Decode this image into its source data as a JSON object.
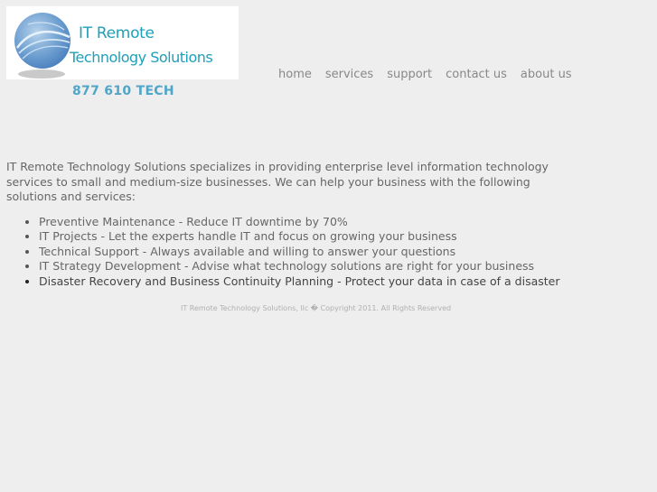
{
  "logo": {
    "line1": "IT Remote",
    "line2": "Technology Solutions"
  },
  "phone": "877 610 TECH",
  "nav": {
    "items": [
      "home",
      "services",
      "support",
      "contact us",
      "about us"
    ]
  },
  "intro": "IT Remote Technology Solutions specializes in providing enterprise level information technology services to small and medium-size businesses. We can help your business with the following solutions and services:",
  "services": [
    "Preventive Maintenance - Reduce IT downtime by 70%",
    "IT Projects - Let the experts handle IT and focus on growing your business",
    "Technical Support - Always available and willing to answer your questions",
    "IT Strategy Development - Advise what technology solutions are right for your business",
    "Disaster Recovery and Business Continuity Planning - Protect your data in case of a disaster"
  ],
  "footer": "IT Remote Technology Solutions, llc � Copyright 2011. All Rights Reserved",
  "colors": {
    "background": "#eeeeee",
    "brand": "#1f9fb9",
    "phone": "#4fa6c9",
    "nav": "#888888",
    "body_text": "#666666"
  }
}
